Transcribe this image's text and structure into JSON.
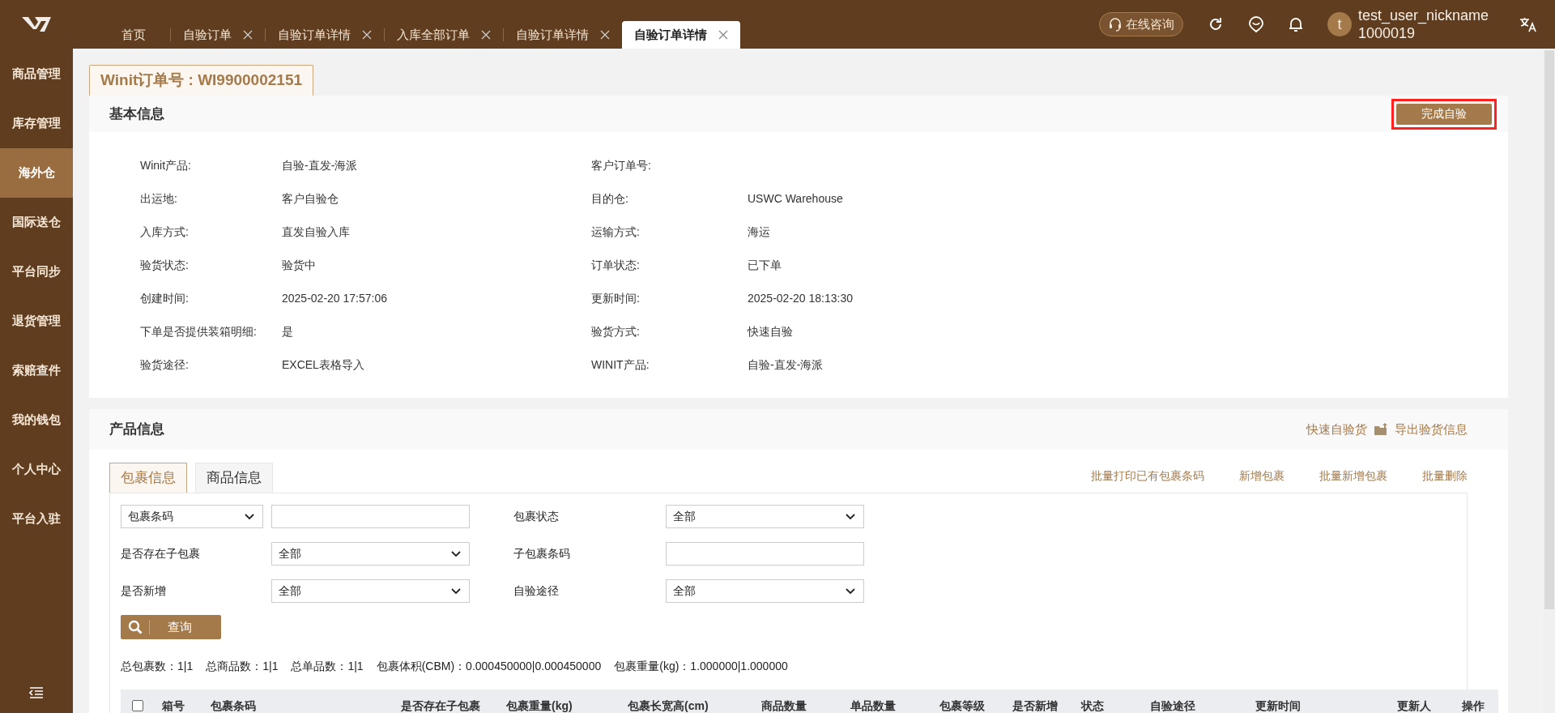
{
  "top_bar": {
    "tabs": [
      {
        "label": "首页",
        "closable": false,
        "selected": false
      },
      {
        "label": "自验订单",
        "closable": true,
        "selected": false
      },
      {
        "label": "自验订单详情",
        "closable": true,
        "selected": false
      },
      {
        "label": "入库全部订单",
        "closable": true,
        "selected": false
      },
      {
        "label": "自验订单详情",
        "closable": true,
        "selected": false
      },
      {
        "label": "自验订单详情",
        "closable": true,
        "selected": true
      }
    ],
    "consult_button": "在线咨询",
    "user": {
      "avatar_letter": "t",
      "nickname": "test_user_nickname",
      "id": "1000019"
    }
  },
  "sidebar": {
    "items": [
      {
        "label": "商品管理",
        "selected": false
      },
      {
        "label": "库存管理",
        "selected": false
      },
      {
        "label": "海外仓",
        "selected": true
      },
      {
        "label": "国际送仓",
        "selected": false
      },
      {
        "label": "平台同步",
        "selected": false
      },
      {
        "label": "退货管理",
        "selected": false
      },
      {
        "label": "索赔查件",
        "selected": false
      },
      {
        "label": "我的钱包",
        "selected": false
      },
      {
        "label": "个人中心",
        "selected": false
      },
      {
        "label": "平台入驻",
        "selected": false
      }
    ]
  },
  "order_tab": {
    "label": "Winit订单号 : WI9900002151"
  },
  "basic_info": {
    "title": "基本信息",
    "action": "完成自验",
    "action_highlighted": true,
    "fields": [
      {
        "label": "Winit产品:",
        "value": "自验-直发-海派"
      },
      {
        "label": "客户订单号:"
      },
      {
        "label": "出运地:",
        "value": "客户自验仓"
      },
      {
        "label": "目的仓:",
        "value": "USWC Warehouse"
      },
      {
        "label": "入库方式:",
        "value": "直发自验入库"
      },
      {
        "label": "运输方式:",
        "value": "海运"
      },
      {
        "label": "验货状态:",
        "value": "验货中"
      },
      {
        "label": "订单状态:",
        "value": "已下单"
      },
      {
        "label": "创建时间:",
        "value": "2025-02-20 17:57:06"
      },
      {
        "label": "更新时间:",
        "value": "2025-02-20 18:13:30"
      },
      {
        "label": "下单是否提供装箱明细:",
        "value": "是"
      },
      {
        "label": "验货方式:",
        "value": "快速自验"
      },
      {
        "label": "验货途径:",
        "value": "EXCEL表格导入"
      },
      {
        "label": "WINIT产品:",
        "value": "自验-直发-海派"
      }
    ]
  },
  "product_info": {
    "title": "产品信息",
    "links": [
      "快速自验货",
      "导出验货信息"
    ],
    "tabs": [
      {
        "label": "包裹信息",
        "selected": true
      },
      {
        "label": "商品信息",
        "selected": false
      }
    ],
    "actions": [
      "批量打印已有包裹条码",
      "新增包裹",
      "批量新增包裹",
      "批量删除"
    ],
    "filters": [
      {
        "kind": "dropdown",
        "value": "包裹条码"
      },
      {
        "kind": "input"
      },
      {
        "kind": "label",
        "text": "包裹状态"
      },
      {
        "kind": "dropdown",
        "value": "全部"
      },
      {
        "kind": "label",
        "text": "是否存在子包裹"
      },
      {
        "kind": "dropdown",
        "value": "全部"
      },
      {
        "kind": "label",
        "text": "子包裹条码"
      },
      {
        "kind": "input"
      },
      {
        "kind": "label",
        "text": "是否新增"
      },
      {
        "kind": "dropdown",
        "value": "全部"
      },
      {
        "kind": "label",
        "text": "自验途径"
      },
      {
        "kind": "dropdown",
        "value": "全部"
      }
    ],
    "query_button": "查询",
    "summary": [
      "总包裹数：1|1",
      "总商品数：1|1",
      "总单品数：1|1",
      "包裹体积(CBM)：0.000450000|0.000450000",
      "包裹重量(kg)：1.000000|1.000000"
    ],
    "table": {
      "select_all_checked": false,
      "columns": [
        "箱号",
        "包裹条码",
        "是否存在子包裹",
        "包裹重量(kg)",
        "包裹长宽高(cm)",
        "商品数量",
        "单品数量",
        "包裹等级",
        "是否新增",
        "状态",
        "自验途径",
        "更新时间",
        "更新人",
        "操作"
      ]
    }
  }
}
